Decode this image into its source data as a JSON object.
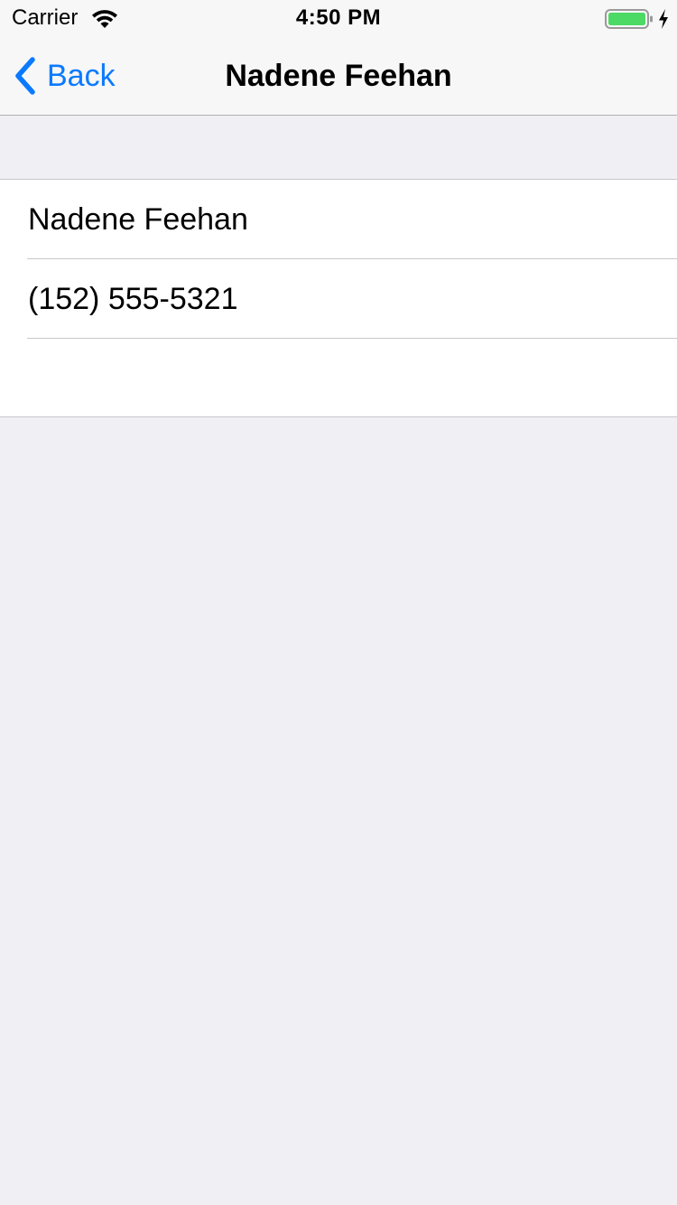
{
  "status_bar": {
    "carrier": "Carrier",
    "time": "4:50 PM",
    "wifi_icon": "wifi-icon",
    "battery_icon": "battery-icon",
    "charging_icon": "bolt-icon",
    "battery_color": "#4cd964"
  },
  "nav": {
    "back_label": "Back",
    "back_icon": "chevron-left-icon",
    "title": "Nadene Feehan",
    "accent": "#0b7aff"
  },
  "contact": {
    "name": "Nadene Feehan",
    "phone": "(152) 555-5321",
    "empty_row": ""
  }
}
